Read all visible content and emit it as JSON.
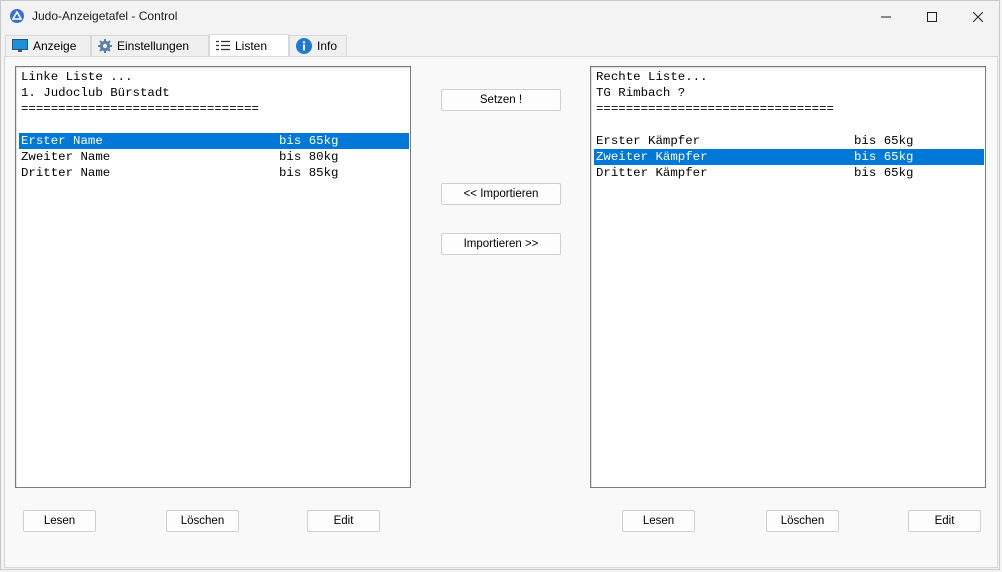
{
  "window": {
    "title": "Judo-Anzeigetafel - Control"
  },
  "tabs": [
    {
      "label": "Anzeige",
      "icon": "monitor-icon"
    },
    {
      "label": "Einstellungen",
      "icon": "gear-icon"
    },
    {
      "label": "Listen",
      "icon": "list-icon",
      "active": true
    },
    {
      "label": "Info",
      "icon": "info-icon"
    }
  ],
  "left_list": {
    "lines": [
      {
        "name": "Linke Liste ...",
        "weight": ""
      },
      {
        "name": "1. Judoclub Bürstadt",
        "weight": ""
      },
      {
        "name": "================================",
        "weight": ""
      },
      {
        "name": "",
        "weight": ""
      },
      {
        "name": "Erster Name",
        "weight": "bis 65kg",
        "selected": true
      },
      {
        "name": "Zweiter Name",
        "weight": "bis 80kg"
      },
      {
        "name": "Dritter Name",
        "weight": "bis 85kg"
      }
    ],
    "buttons": {
      "read": "Lesen",
      "delete": "Löschen",
      "edit": "Edit"
    }
  },
  "right_list": {
    "lines": [
      {
        "name": "Rechte Liste...",
        "weight": ""
      },
      {
        "name": "TG Rimbach ?",
        "weight": ""
      },
      {
        "name": "================================",
        "weight": ""
      },
      {
        "name": "",
        "weight": ""
      },
      {
        "name": "Erster Kämpfer",
        "weight": "bis 65kg"
      },
      {
        "name": "Zweiter Kämpfer",
        "weight": "bis 65kg",
        "selected": true
      },
      {
        "name": "Dritter Kämpfer",
        "weight": "bis 65kg"
      }
    ],
    "buttons": {
      "read": "Lesen",
      "delete": "Löschen",
      "edit": "Edit"
    }
  },
  "center_buttons": {
    "set": "Setzen !",
    "import_left": "<< Importieren",
    "import_right": "Importieren >>"
  },
  "colors": {
    "selection": "#0078d7",
    "window_bg": "#f3f3f3"
  }
}
